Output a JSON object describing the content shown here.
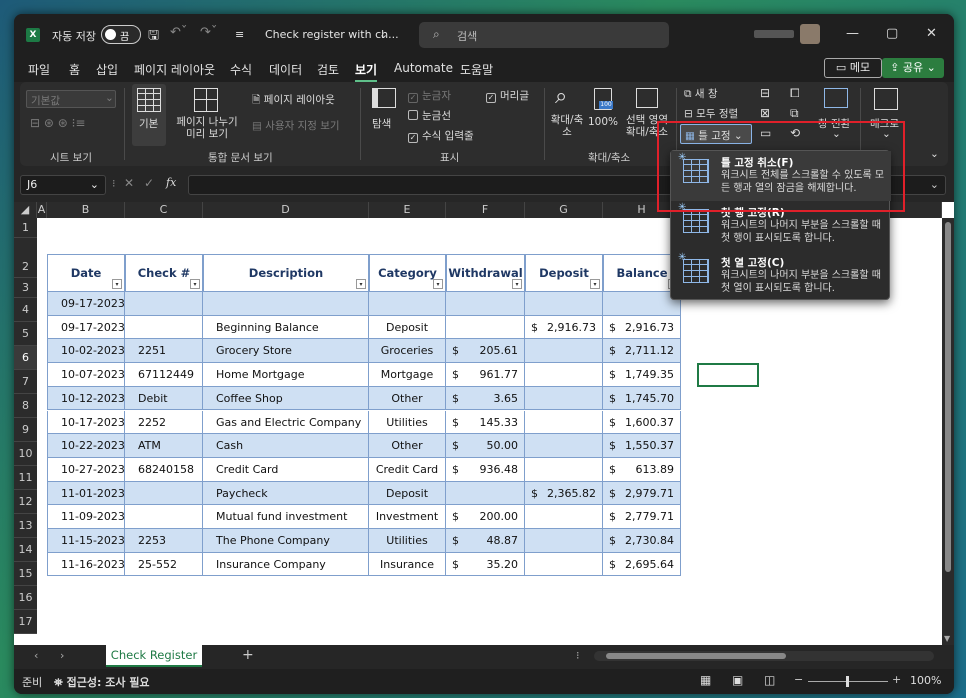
{
  "titlebar": {
    "app_icon": "excel-logo",
    "autosave_label": "자동 저장",
    "autosave_state": "끔",
    "filename": "Check register with ch...",
    "search_placeholder": "검색",
    "account": "",
    "minimize": "—",
    "maximize": "▢",
    "close": "✕"
  },
  "menu": {
    "items": [
      "파일",
      "홈",
      "삽입",
      "페이지 레이아웃",
      "수식",
      "데이터",
      "검토",
      "보기",
      "Automate",
      "도움말"
    ],
    "active": "보기",
    "memo": "메모",
    "share": "공유"
  },
  "ribbon": {
    "sheet_view": {
      "dropdown": "기본값",
      "group": "시트 보기"
    },
    "workbook_views": {
      "normal": "기본",
      "page_break": "페이지 나누기 미리 보기",
      "page_layout": "페이지 레이아웃",
      "custom_views": "사용자 지정 보기",
      "group": "통합 문서 보기"
    },
    "show": {
      "navigate": "탐색",
      "ruler": "눈금자",
      "gridlines": "눈금선",
      "formula_bar": "수식 입력줄",
      "headings": "머리글",
      "group": "표시"
    },
    "zoom": {
      "zoom": "확대/축소",
      "zoom100": "100%",
      "zoom_selection": "선택 영역 확대/축소",
      "group": "확대/축소"
    },
    "window": {
      "new_window": "새 창",
      "arrange_all": "모두 정렬",
      "freeze_panes": "틀 고정",
      "switch_windows": "창 전환",
      "macros": "매크로"
    }
  },
  "formula_bar": {
    "name_box": "J6",
    "fx": "fx",
    "value": ""
  },
  "columns": [
    "A",
    "B",
    "C",
    "D",
    "E",
    "F",
    "G",
    "H"
  ],
  "rows": [
    "1",
    "2",
    "3",
    "4",
    "5",
    "6",
    "7",
    "8",
    "9",
    "10",
    "11",
    "12",
    "13",
    "14",
    "15",
    "16",
    "17"
  ],
  "table": {
    "headers": [
      "Date",
      "Check #",
      "Description",
      "Category",
      "Withdrawal",
      "Deposit",
      "Balance"
    ],
    "rows": [
      {
        "date": "09-17-2023",
        "check": "",
        "desc": "",
        "cat": "",
        "wd": "",
        "dep": "",
        "bal": ""
      },
      {
        "date": "09-17-2023",
        "check": "",
        "desc": "Beginning Balance",
        "cat": "Deposit",
        "wd": "",
        "dep": "2,916.73",
        "bal": "2,916.73"
      },
      {
        "date": "10-02-2023",
        "check": "2251",
        "desc": "Grocery Store",
        "cat": "Groceries",
        "wd": "205.61",
        "dep": "",
        "bal": "2,711.12"
      },
      {
        "date": "10-07-2023",
        "check": "67112449",
        "desc": "Home Mortgage",
        "cat": "Mortgage",
        "wd": "961.77",
        "dep": "",
        "bal": "1,749.35"
      },
      {
        "date": "10-12-2023",
        "check": "Debit",
        "desc": "Coffee Shop",
        "cat": "Other",
        "wd": "3.65",
        "dep": "",
        "bal": "1,745.70"
      },
      {
        "date": "10-17-2023",
        "check": "2252",
        "desc": "Gas and Electric Company",
        "cat": "Utilities",
        "wd": "145.33",
        "dep": "",
        "bal": "1,600.37"
      },
      {
        "date": "10-22-2023",
        "check": "ATM",
        "desc": "Cash",
        "cat": "Other",
        "wd": "50.00",
        "dep": "",
        "bal": "1,550.37"
      },
      {
        "date": "10-27-2023",
        "check": "68240158",
        "desc": "Credit Card",
        "cat": "Credit Card",
        "wd": "936.48",
        "dep": "",
        "bal": "613.89"
      },
      {
        "date": "11-01-2023",
        "check": "",
        "desc": "Paycheck",
        "cat": "Deposit",
        "wd": "",
        "dep": "2,365.82",
        "bal": "2,979.71"
      },
      {
        "date": "11-09-2023",
        "check": "",
        "desc": "Mutual fund investment",
        "cat": "Investment",
        "wd": "200.00",
        "dep": "",
        "bal": "2,779.71"
      },
      {
        "date": "11-15-2023",
        "check": "2253",
        "desc": "The Phone Company",
        "cat": "Utilities",
        "wd": "48.87",
        "dep": "",
        "bal": "2,730.84"
      },
      {
        "date": "11-16-2023",
        "check": "25-552",
        "desc": "Insurance Company",
        "cat": "Insurance",
        "wd": "35.20",
        "dep": "",
        "bal": "2,695.64"
      }
    ]
  },
  "freeze_menu": {
    "items": [
      {
        "title": "틀 고정 취소(F)",
        "desc": "워크시트 전체를 스크롤할 수 있도록 모든 행과 열의 잠금을 해제합니다."
      },
      {
        "title": "첫 행 고정(R)",
        "desc": "워크시트의 나머지 부분을 스크롤할 때 첫 행이 표시되도록 합니다."
      },
      {
        "title": "첫 열 고정(C)",
        "desc": "워크시트의 나머지 부분을 스크롤할 때 첫 열이 표시되도록 합니다."
      }
    ]
  },
  "tabs": {
    "sheet": "Check Register",
    "add": "+"
  },
  "status": {
    "ready": "준비",
    "accessibility": "접근성: 조사 필요",
    "zoom": "100%"
  },
  "colors": {
    "accent": "#5fc08a",
    "highlight": "#e0202a",
    "band": "#cfe0f3"
  }
}
